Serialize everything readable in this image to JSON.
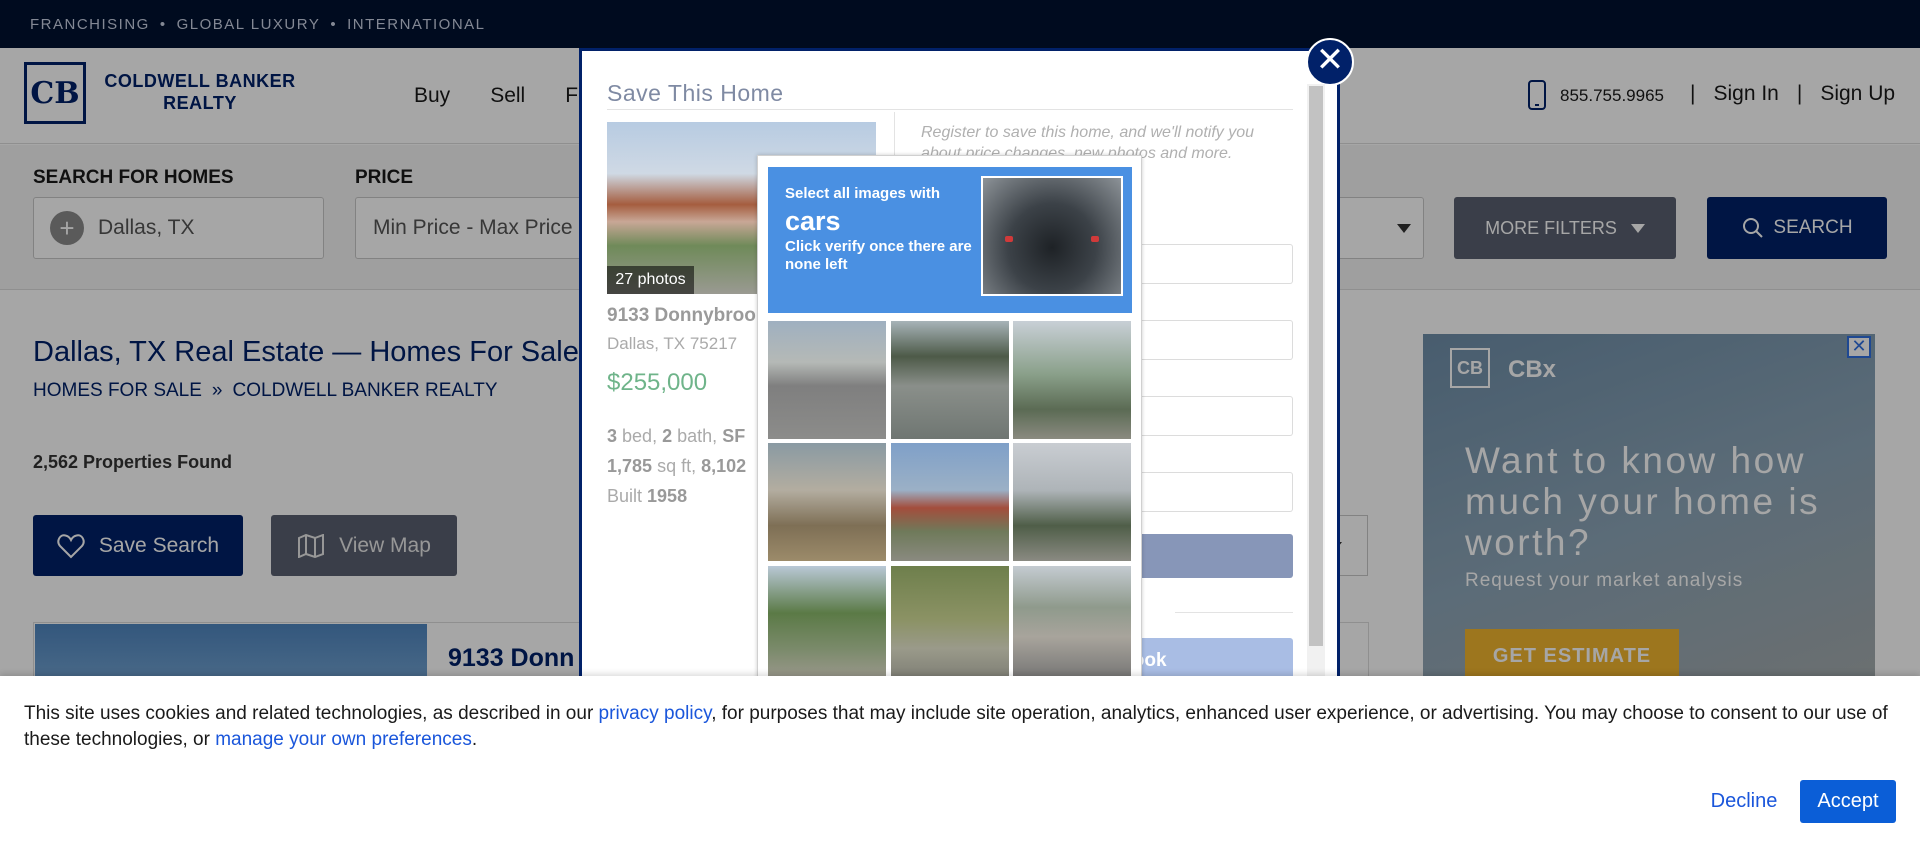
{
  "topbar": {
    "items": [
      "FRANCHISING",
      "GLOBAL LUXURY",
      "INTERNATIONAL"
    ],
    "separator": "•"
  },
  "header": {
    "logo_mark": "CB",
    "logo_line1": "COLDWELL BANKER",
    "logo_line2": "REALTY",
    "nav": [
      "Buy",
      "Sell",
      "F"
    ],
    "phone": "855.755.9965",
    "sign_in": "Sign In",
    "sign_up": "Sign Up",
    "divider": "|"
  },
  "search": {
    "label_homes": "SEARCH FOR HOMES",
    "location_value": "Dallas, TX",
    "label_price": "PRICE",
    "price_value": "Min Price  -  Max Price",
    "more_filters": "MORE FILTERS",
    "search_button": "SEARCH"
  },
  "content": {
    "title": "Dallas, TX Real Estate — Homes For Sale",
    "breadcrumb": [
      "HOMES FOR SALE",
      "COLDWELL BANKER REALTY"
    ],
    "breadcrumb_sep": "»",
    "count": "2,562 Properties Found",
    "save_search": "Save Search",
    "view_map": "View Map",
    "listing_title": "9133 Donn"
  },
  "ad": {
    "logo": "CB",
    "brand": "CBx",
    "headline": "Want to know how much your home is worth?",
    "sub": "Request your market analysis",
    "cta": "GET ESTIMATE",
    "close": "✕"
  },
  "modal": {
    "title": "Save This Home",
    "close": "✕",
    "photos": "27 photos",
    "address": "9133 Donnybroo",
    "city": "Dallas, TX 75217",
    "price": "$255,000",
    "beds": "3",
    "beds_label": "bed,",
    "baths": "2",
    "baths_label": "bath,",
    "type": "SF",
    "sqft": "1,785",
    "sqft_label": "sq ft,",
    "lot": "8,102",
    "built_label": "Built",
    "built": "1958",
    "register_text": "Register to save this home, and we'll notify you about price changes, new photos and more.",
    "input_hint": "m",
    "continue_tail": "ne",
    "orform_tail": "orm",
    "facebook_tail": "cebook"
  },
  "captcha": {
    "prompt_small": "Select all images with",
    "target": "cars",
    "note": "Click verify once there are none left",
    "tiles": [
      "t-road",
      "t-bridge",
      "t-palm",
      "t-over",
      "t-chim",
      "t-light",
      "t-tree",
      "t-hill",
      "t-street"
    ]
  },
  "cookie": {
    "text_a": "This site uses cookies and related technologies, as described in our ",
    "link_privacy": "privacy policy",
    "text_b": ", for purposes that may include site operation, analytics, enhanced user experience, or advertising. You may choose to consent to our use of these technologies, or ",
    "link_prefs": "manage your own preferences",
    "text_c": ".",
    "decline": "Decline",
    "accept": "Accept"
  },
  "colors": {
    "brand_navy": "#012169",
    "accent_blue": "#0b5ed7",
    "captcha_blue": "#4a90e2"
  }
}
